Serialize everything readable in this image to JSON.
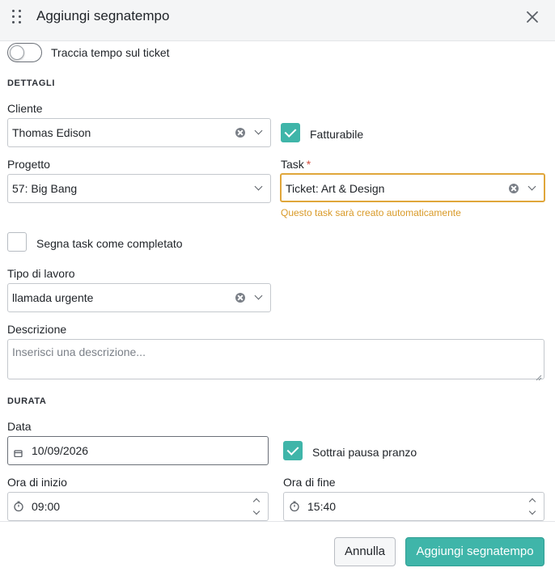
{
  "header": {
    "title": "Aggiungi segnatempo",
    "drag_icon": "drag-handle-icon",
    "close_icon": "close-icon"
  },
  "track_toggle": {
    "label": "Traccia tempo sul ticket",
    "on": false
  },
  "details": {
    "section_title": "DETTAGLI",
    "client": {
      "label": "Cliente",
      "value": "Thomas Edison"
    },
    "billable": {
      "label": "Fatturabile",
      "checked": true
    },
    "project": {
      "label": "Progetto",
      "value": "57: Big Bang"
    },
    "task": {
      "label": "Task",
      "required_mark": "*",
      "value": "Ticket: Art & Design",
      "hint": "Questo task sarà creato automaticamente"
    },
    "mark_complete": {
      "label": "Segna task come completato",
      "checked": false
    },
    "work_type": {
      "label": "Tipo di lavoro",
      "value": "llamada urgente"
    },
    "description": {
      "label": "Descrizione",
      "placeholder": "Inserisci una descrizione...",
      "value": ""
    }
  },
  "duration": {
    "section_title": "DURATA",
    "date": {
      "label": "Data",
      "value": "10/09/2026",
      "icon": "calendar-icon"
    },
    "lunch_break": {
      "label": "Sottrai pausa pranzo",
      "checked": true
    },
    "start_time": {
      "label": "Ora di inizio",
      "value": "09:00",
      "icon": "clock-icon"
    },
    "end_time": {
      "label": "Ora di fine",
      "value": "15:40",
      "icon": "clock-icon"
    }
  },
  "footer": {
    "cancel_label": "Annulla",
    "submit_label": "Aggiungi segnatempo"
  },
  "colors": {
    "accent": "#3fb5a9",
    "focus_border": "#e0a63a",
    "hint_text": "#d99a28",
    "required": "#d24b3c"
  }
}
